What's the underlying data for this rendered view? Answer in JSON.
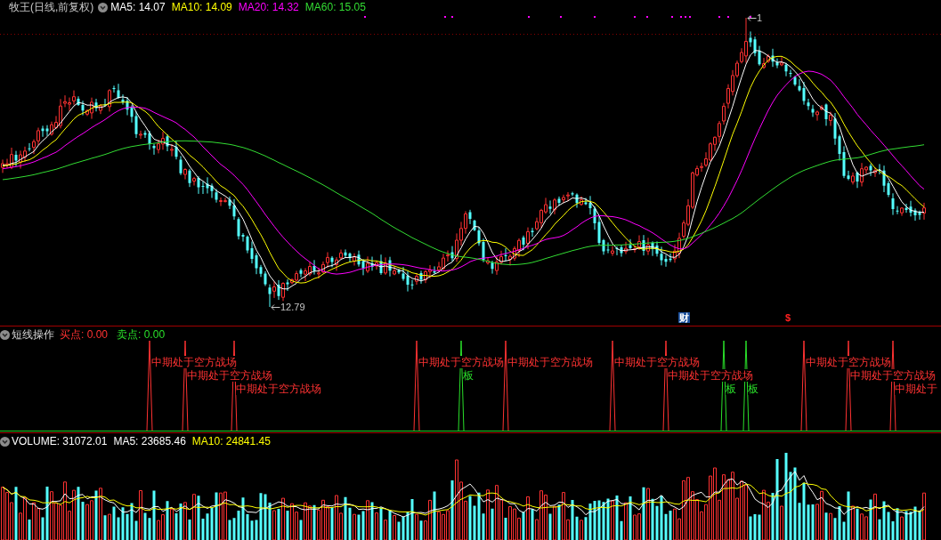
{
  "main_chart": {
    "title": "牧王(日线,前复权)",
    "indicators": [
      {
        "text": "MA5: 14.07",
        "color": "#ffffff"
      },
      {
        "text": "MA10: 14.09",
        "color": "#ffff00"
      },
      {
        "text": "MA20: 14.32",
        "color": "#ff00ff"
      },
      {
        "text": "MA60: 15.05",
        "color": "#33dd33"
      }
    ],
    "price_labels": [
      {
        "kind": "high",
        "text": "1"
      },
      {
        "kind": "low",
        "text": "12.79"
      }
    ],
    "event_markers": [
      {
        "kind": "finance",
        "text": "财"
      },
      {
        "kind": "dividend",
        "text": "$"
      }
    ]
  },
  "signal_panel": {
    "title": "短线操作",
    "readings": [
      {
        "kind": "buy",
        "text": "买点: 0.00"
      },
      {
        "kind": "sell",
        "text": "卖点: 0.00"
      }
    ],
    "signals": [
      {
        "kind": "buy",
        "label": "中期处于空方战场"
      },
      {
        "kind": "buy",
        "label": "中期处于空方战场"
      },
      {
        "kind": "buy",
        "label": "中期处于空方战场"
      },
      {
        "kind": "buy",
        "label": "中期处于空方战场"
      },
      {
        "kind": "sell",
        "label": "板"
      },
      {
        "kind": "buy",
        "label": "中期处于空方战场"
      },
      {
        "kind": "buy",
        "label": "中期处于空方战场"
      },
      {
        "kind": "buy",
        "label": "中期处于空方战场"
      },
      {
        "kind": "sell",
        "label": "板"
      },
      {
        "kind": "sell",
        "label": "板"
      },
      {
        "kind": "buy",
        "label": "中期处于空方战场"
      },
      {
        "kind": "buy",
        "label": "中期处于空方战场"
      },
      {
        "kind": "buy",
        "label": "中期处于"
      }
    ]
  },
  "volume_panel": {
    "readings": [
      {
        "text": "VOLUME: 31072.01",
        "color": "#ffffff"
      },
      {
        "text": "MA5: 23685.46",
        "color": "#ffffff"
      },
      {
        "text": "MA10: 24841.45",
        "color": "#ffff00"
      }
    ]
  }
}
